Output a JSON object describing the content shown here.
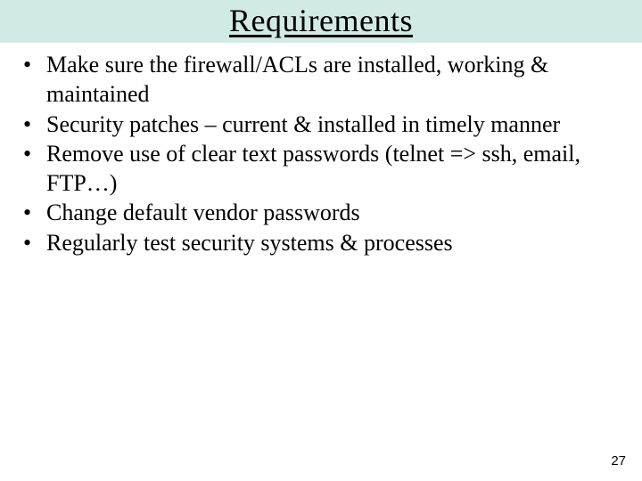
{
  "slide": {
    "title": "Requirements",
    "bullets": [
      "Make sure the firewall/ACLs are installed, working & maintained",
      "Security patches – current & installed in timely manner",
      "Remove use of clear text passwords (telnet => ssh, email, FTP…)",
      "Change default vendor passwords",
      "Regularly test security systems & processes"
    ],
    "page_number": "27"
  }
}
